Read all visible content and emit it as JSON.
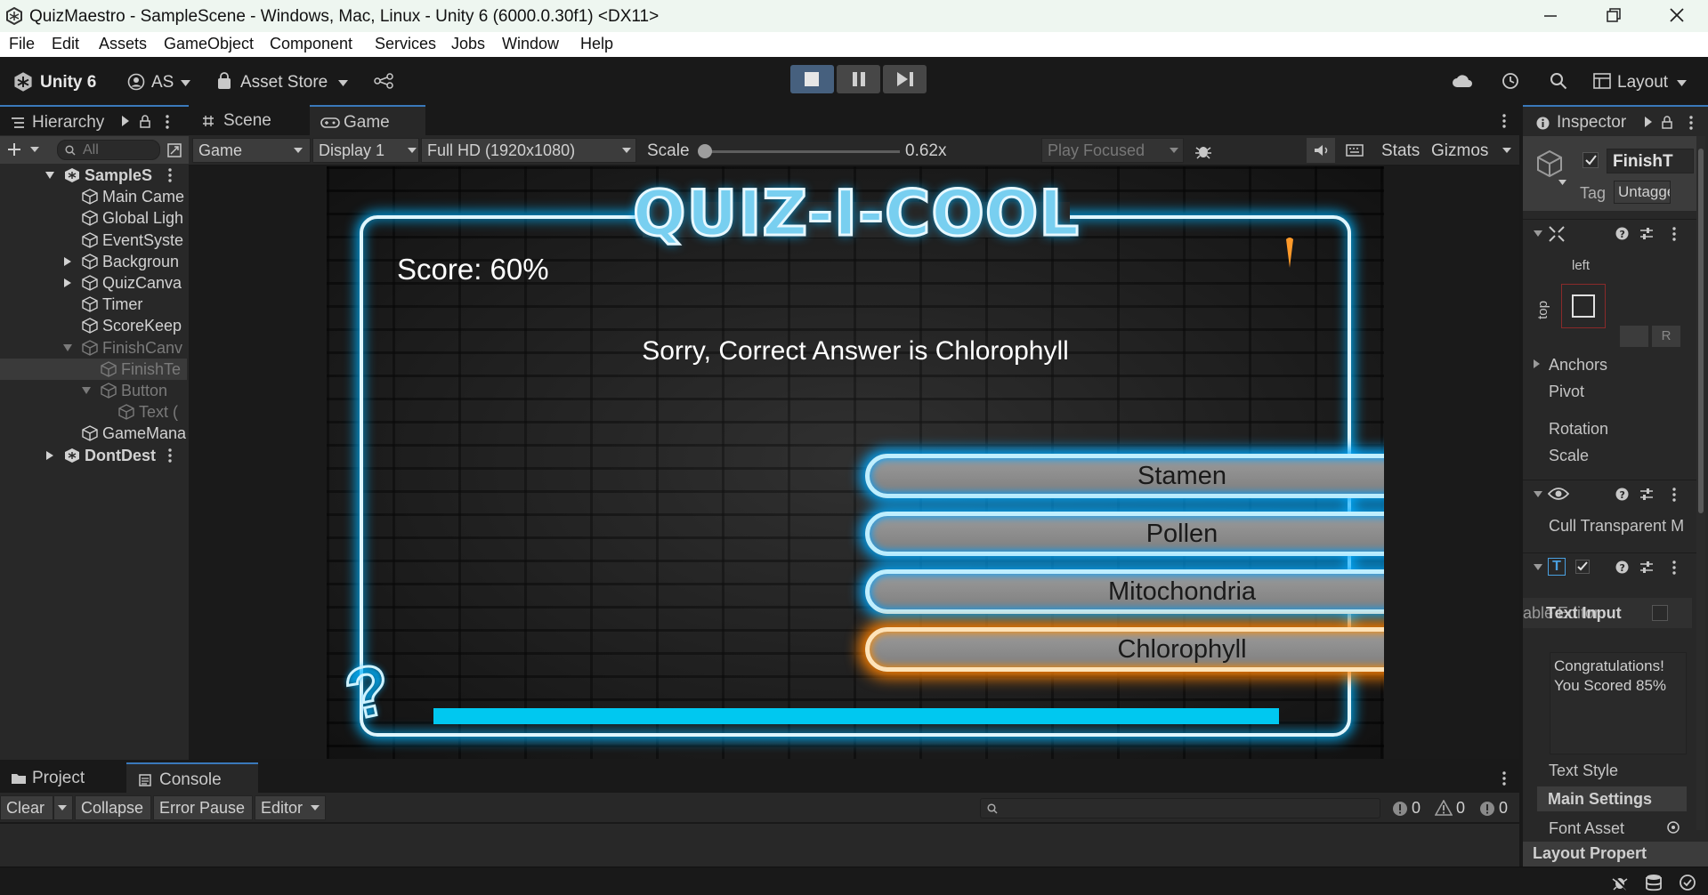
{
  "window": {
    "title": "QuizMaestro - SampleScene - Windows, Mac, Linux - Unity 6 (6000.0.30f1) <DX11>"
  },
  "menu": [
    "File",
    "Edit",
    "Assets",
    "GameObject",
    "Component",
    "Services",
    "Jobs",
    "Window",
    "Help"
  ],
  "toolbar": {
    "unity": "Unity 6",
    "account": "AS",
    "asset_store": "Asset Store",
    "layout": "Layout"
  },
  "tabs": {
    "hierarchy": "Hierarchy",
    "scene": "Scene",
    "game": "Game",
    "inspector": "Inspector",
    "project": "Project",
    "console": "Console"
  },
  "hierarchy": {
    "search_placeholder": "All",
    "items": [
      {
        "label": "SampleS",
        "indent": 0,
        "dim": false
      },
      {
        "label": "Main Came",
        "indent": 1,
        "dim": false
      },
      {
        "label": "Global Ligh",
        "indent": 1,
        "dim": false
      },
      {
        "label": "EventSyste",
        "indent": 1,
        "dim": false
      },
      {
        "label": "Backgroun",
        "indent": 1,
        "dim": false
      },
      {
        "label": "QuizCanva",
        "indent": 1,
        "dim": false
      },
      {
        "label": "Timer",
        "indent": 1,
        "dim": false
      },
      {
        "label": "ScoreKeep",
        "indent": 1,
        "dim": false
      },
      {
        "label": "FinishCanv",
        "indent": 1,
        "dim": true
      },
      {
        "label": "FinishTe",
        "indent": 2,
        "dim": true
      },
      {
        "label": "Button",
        "indent": 2,
        "dim": true
      },
      {
        "label": "Text (",
        "indent": 3,
        "dim": true
      },
      {
        "label": "GameMana",
        "indent": 1,
        "dim": false
      },
      {
        "label": "DontDest",
        "indent": 0,
        "dim": false
      }
    ]
  },
  "game_toolbar": {
    "view": "Game",
    "display": "Display 1",
    "resolution": "Full HD (1920x1080)",
    "scale_label": "Scale",
    "scale_value": "0.62x",
    "play_focused": "Play Focused",
    "stats": "Stats",
    "gizmos": "Gizmos"
  },
  "game": {
    "title": "QUIZ-I-COOL",
    "score": "Score: 60%",
    "message": "Sorry, Correct Answer is Chlorophyll",
    "answers": [
      "Stamen",
      "Pollen",
      "Mitochondria",
      "Chlorophyll"
    ],
    "correct_index": 3,
    "timer_fraction": 1.0,
    "accent": "#00c8f0",
    "highlight": "#ff8a00"
  },
  "inspector": {
    "object_name": "FinishT",
    "tag_label": "Tag",
    "tag_value": "Untagged",
    "rect_left": "left",
    "rect_top": "top",
    "anchors": "Anchors",
    "pivot": "Pivot",
    "rotation": "Rotation",
    "scale": "Scale",
    "cull": "Cull Transparent M",
    "text_input_label": "Text Input",
    "editor_label": "able Editor",
    "text_value_1": "Congratulations!",
    "text_value_2": "You Scored 85%",
    "text_style": "Text Style",
    "main_settings": "Main Settings",
    "font_asset": "Font Asset",
    "layout_props": "Layout Propert"
  },
  "console": {
    "clear": "Clear",
    "collapse": "Collapse",
    "error_pause": "Error Pause",
    "editor": "Editor",
    "info_count": "0",
    "warn_count": "0",
    "error_count": "0"
  }
}
